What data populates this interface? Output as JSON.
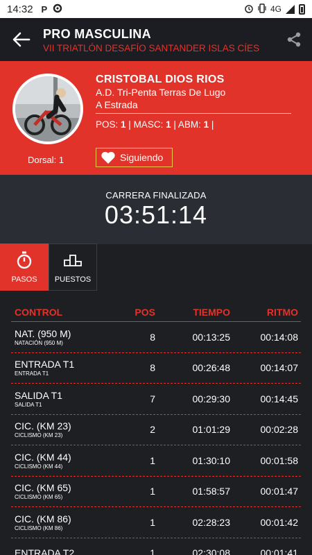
{
  "status_bar": {
    "time": "14:32",
    "network": "4G"
  },
  "header": {
    "title": "PRO MASCULINA",
    "subtitle": "VII TRIATLÓN DESAFÍO SANTANDER ISLAS CÍES"
  },
  "athlete": {
    "name": "CRISTOBAL DIOS RIOS",
    "club": "A.D. Tri-Penta Terras De Lugo",
    "city": "A Estrada",
    "dorsal_label": "Dorsal:",
    "dorsal_value": "1",
    "pos_label": "POS:",
    "pos_value": "1",
    "masc_label": "MASC:",
    "masc_value": "1",
    "abm_label": "ABM:",
    "abm_value": "1",
    "follow_label": "Siguiendo"
  },
  "race": {
    "status": "CARRERA FINALIZADA",
    "time": "03:51:14"
  },
  "tabs": [
    {
      "label": "PASOS",
      "icon": "stopwatch-icon",
      "active": true
    },
    {
      "label": "PUESTOS",
      "icon": "podium-icon",
      "active": false
    }
  ],
  "table": {
    "headers": {
      "control": "CONTROL",
      "pos": "POS",
      "time": "TIEMPO",
      "pace": "RITMO"
    },
    "rows": [
      {
        "control": "NAT. (950 M)",
        "sub": "NATACIÓN (950 M)",
        "pos": "8",
        "time": "00:13:25",
        "pace": "00:14:08"
      },
      {
        "control": "ENTRADA T1",
        "sub": "ENTRADA T1",
        "pos": "8",
        "time": "00:26:48",
        "pace": "00:14:07"
      },
      {
        "control": "SALIDA T1",
        "sub": "SALIDA T1",
        "pos": "7",
        "time": "00:29:30",
        "pace": "00:14:45"
      },
      {
        "control": "CIC. (KM 23)",
        "sub": "CICLISMO (KM 23)",
        "pos": "2",
        "time": "01:01:29",
        "pace": "00:02:28"
      },
      {
        "control": "CIC. (KM 44)",
        "sub": "CICLISMO (KM 44)",
        "pos": "1",
        "time": "01:30:10",
        "pace": "00:01:58"
      },
      {
        "control": "CIC. (KM 65)",
        "sub": "CICLISMO (KM 65)",
        "pos": "1",
        "time": "01:58:57",
        "pace": "00:01:47"
      },
      {
        "control": "CIC. (KM 86)",
        "sub": "CICLISMO (KM 86)",
        "pos": "1",
        "time": "02:28:23",
        "pace": "00:01:42"
      },
      {
        "control": "ENTRADA T2",
        "sub": "",
        "pos": "1",
        "time": "02:30:08",
        "pace": "00:01:41"
      }
    ]
  },
  "colors": {
    "accent": "#e2332b",
    "header_bg": "#1b1d22",
    "body_bg": "#1e1f23",
    "panel_bg": "#2a2d33",
    "follow_border": "#f2c94c"
  }
}
